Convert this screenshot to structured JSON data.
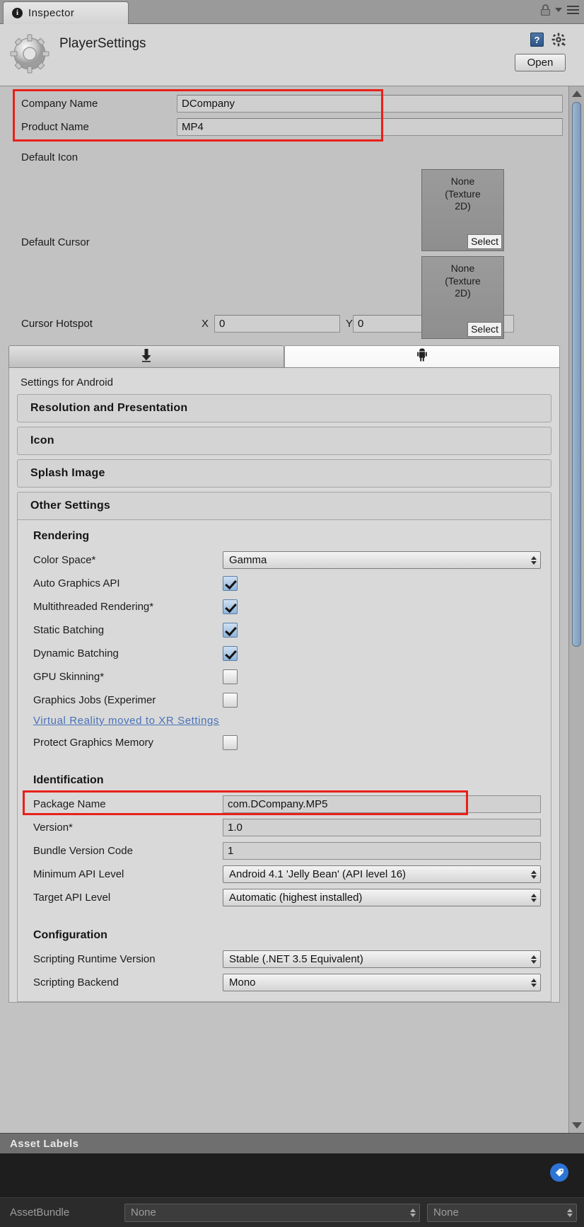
{
  "window": {
    "tab_label": "Inspector",
    "tab_icon": "info-icon",
    "lock_icon": "lock-icon",
    "menu_icon": "hamburger-menu-icon",
    "dropdown_icon": "chevron-down-icon"
  },
  "object_header": {
    "title": "PlayerSettings",
    "logo_icon": "gear-settings-icon",
    "help_icon": "help-book-icon",
    "help_label": "?",
    "gear_icon": "gear-icon",
    "open_label": "Open"
  },
  "top_fields": {
    "company_name": {
      "label": "Company Name",
      "value": "DCompany"
    },
    "product_name": {
      "label": "Product Name",
      "value": "MP4"
    },
    "default_icon": {
      "label": "Default Icon",
      "value_line1": "None",
      "value_line2": "(Texture",
      "value_line3": "2D)",
      "select_label": "Select"
    },
    "default_cursor": {
      "label": "Default Cursor",
      "value_line1": "None",
      "value_line2": "(Texture",
      "value_line3": "2D)",
      "select_label": "Select"
    },
    "cursor_hotspot": {
      "label": "Cursor Hotspot",
      "x_label": "X",
      "x_value": "0",
      "y_label": "Y",
      "y_value": "0"
    }
  },
  "platform_tabs": [
    {
      "name": "standalone",
      "icon": "download-arrow-icon",
      "active": false
    },
    {
      "name": "android",
      "icon": "android-robot-icon",
      "active": true
    }
  ],
  "settings": {
    "panel_title": "Settings for Android",
    "foldouts": [
      {
        "label": "Resolution and Presentation",
        "open": false
      },
      {
        "label": "Icon",
        "open": false
      },
      {
        "label": "Splash Image",
        "open": false
      },
      {
        "label": "Other Settings",
        "open": true
      }
    ],
    "rendering": {
      "heading": "Rendering",
      "color_space": {
        "label": "Color Space*",
        "value": "Gamma",
        "type": "dropdown"
      },
      "auto_graphics_api": {
        "label": "Auto Graphics API",
        "checked": true
      },
      "multithreaded_rendering": {
        "label": "Multithreaded Rendering*",
        "checked": true
      },
      "static_batching": {
        "label": "Static Batching",
        "checked": true
      },
      "dynamic_batching": {
        "label": "Dynamic Batching",
        "checked": true
      },
      "gpu_skinning": {
        "label": "GPU Skinning*",
        "checked": false
      },
      "graphics_jobs": {
        "label": "Graphics Jobs (Experimer",
        "checked": false
      },
      "vr_link": "Virtual Reality moved to XR Settings",
      "protect_graphics_memory": {
        "label": "Protect Graphics Memory",
        "checked": false
      }
    },
    "identification": {
      "heading": "Identification",
      "package_name": {
        "label": "Package Name",
        "value": "com.DCompany.MP5"
      },
      "version": {
        "label": "Version*",
        "value": "1.0"
      },
      "bundle_version_code": {
        "label": "Bundle Version Code",
        "value": "1"
      },
      "minimum_api_level": {
        "label": "Minimum API Level",
        "value": "Android 4.1 'Jelly Bean' (API level 16)"
      },
      "target_api_level": {
        "label": "Target API Level",
        "value": "Automatic (highest installed)"
      }
    },
    "configuration": {
      "heading": "Configuration",
      "scripting_runtime_version": {
        "label": "Scripting Runtime Version",
        "value": "Stable (.NET 3.5 Equivalent)"
      },
      "scripting_backend": {
        "label": "Scripting Backend",
        "value": "Mono"
      }
    }
  },
  "asset_labels": {
    "header": "Asset Labels",
    "tag_icon": "label-tag-icon",
    "assetbundle_label": "AssetBundle",
    "assetbundle_value": "None",
    "variant_value": "None"
  },
  "highlights": {
    "accent_red": "#e8201a",
    "link_blue": "#4a72b8",
    "checkbox_blue": "#8fb4db"
  }
}
